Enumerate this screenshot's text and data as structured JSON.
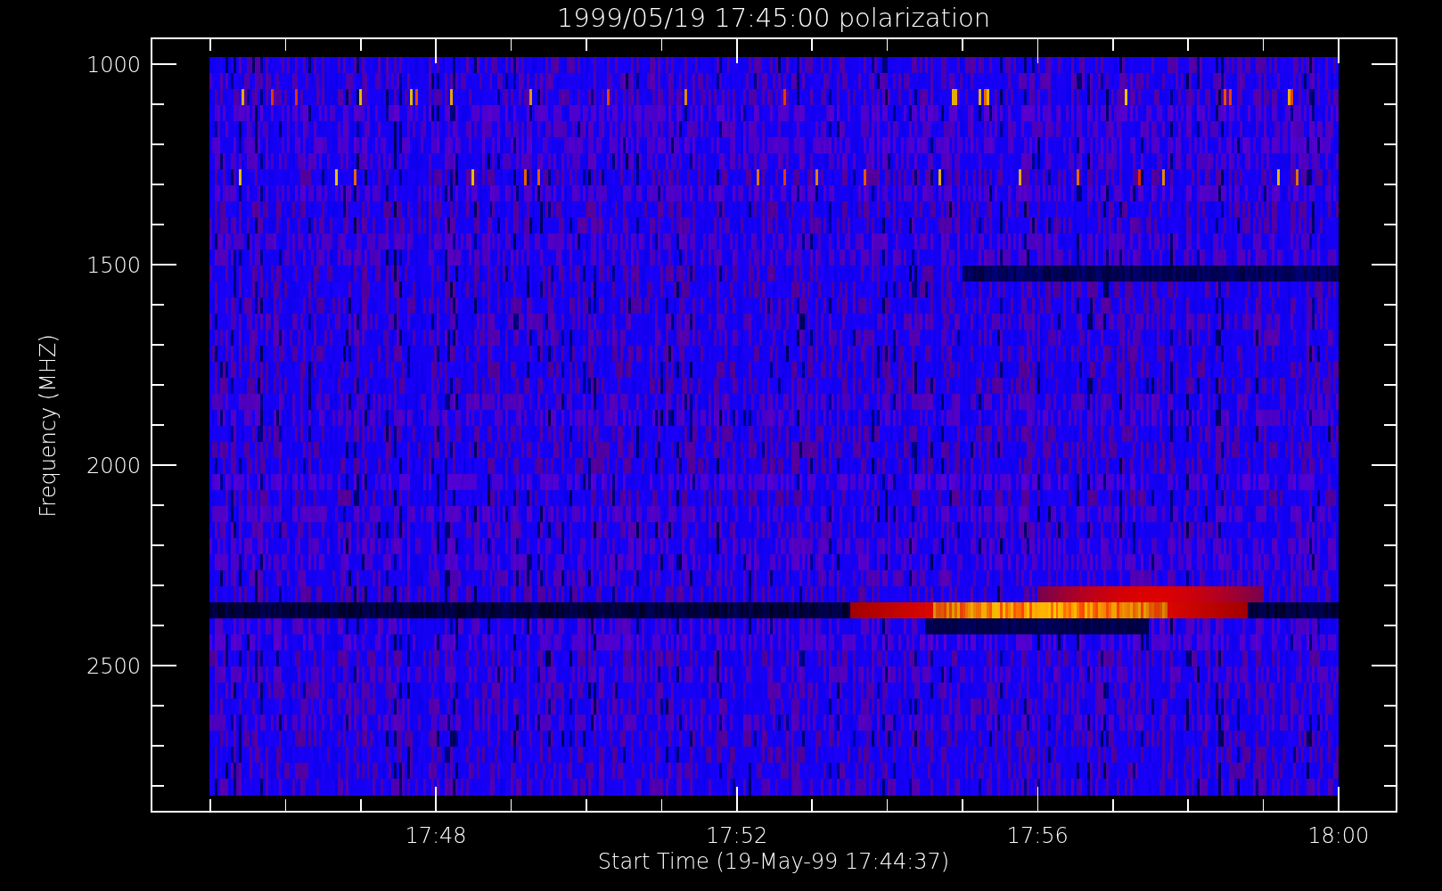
{
  "title": "1999/05/19 17:45:00 polarization",
  "y_axis": {
    "label": "Frequency (MHZ)",
    "ticks": [
      "1000",
      "1500",
      "2000",
      "2500"
    ]
  },
  "x_axis": {
    "label": "Start Time (19-May-99 17:44:37)",
    "ticks": [
      "17:48",
      "17:52",
      "17:56",
      "18:00"
    ]
  }
}
